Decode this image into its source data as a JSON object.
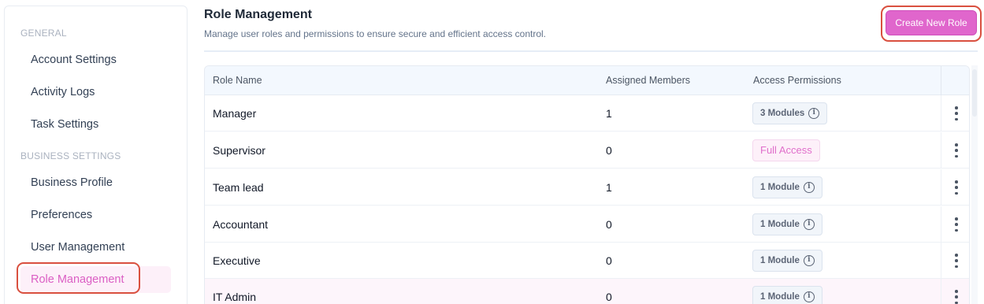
{
  "sidebar": {
    "sections": [
      {
        "label": "GENERAL",
        "items": [
          "Account Settings",
          "Activity Logs",
          "Task Settings"
        ]
      },
      {
        "label": "BUSINESS SETTINGS",
        "items": [
          "Business Profile",
          "Preferences",
          "User Management",
          "Role Management"
        ]
      }
    ],
    "active_item": "Role Management"
  },
  "header": {
    "title": "Role Management",
    "subtitle": "Manage user roles and permissions to ensure secure and efficient access control.",
    "create_button": "Create New Role"
  },
  "table": {
    "columns": [
      "Role Name",
      "Assigned Members",
      "Access Permissions"
    ],
    "rows": [
      {
        "role": "Manager",
        "members": "1",
        "access": "3 Modules"
      },
      {
        "role": "Supervisor",
        "members": "0",
        "access": "Full Access"
      },
      {
        "role": "Team lead",
        "members": "1",
        "access": "1 Module"
      },
      {
        "role": "Accountant",
        "members": "0",
        "access": "1 Module"
      },
      {
        "role": "Executive",
        "members": "0",
        "access": "1 Module"
      },
      {
        "role": "IT Admin",
        "members": "0",
        "access": "1 Module"
      }
    ]
  },
  "colors": {
    "accent": "#e066cc",
    "highlight_outline": "#d9503f"
  },
  "icons": {
    "info": "info-circle-icon",
    "row_actions": "kebab-menu-icon"
  }
}
